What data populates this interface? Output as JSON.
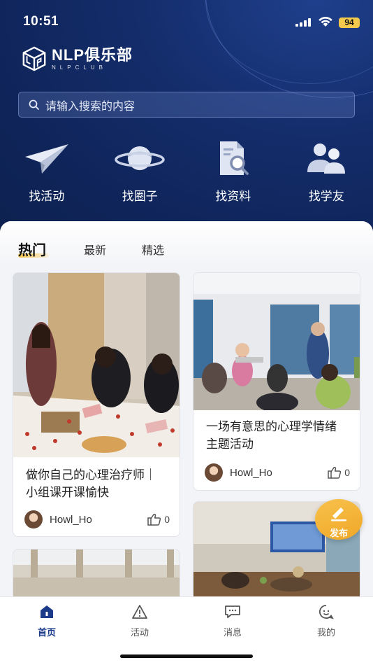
{
  "status": {
    "time": "10:51",
    "battery": "94"
  },
  "brand": {
    "name": "NLP俱乐部",
    "sub": "NLPCLUB"
  },
  "search": {
    "placeholder": "请输入搜索的内容"
  },
  "quick_links": [
    {
      "label": "找活动",
      "icon": "paper-plane-icon"
    },
    {
      "label": "找圈子",
      "icon": "planet-icon"
    },
    {
      "label": "找资料",
      "icon": "document-search-icon"
    },
    {
      "label": "找学友",
      "icon": "users-icon"
    }
  ],
  "feed_tabs": [
    {
      "label": "热门",
      "active": true
    },
    {
      "label": "最新",
      "active": false
    },
    {
      "label": "精选",
      "active": false
    }
  ],
  "posts": [
    {
      "title": "做你自己的心理治疗师｜小组课开课愉快",
      "author": "Howl_Ho",
      "likes": "0"
    },
    {
      "title": "一场有意思的心理学情绪主题活动",
      "author": "Howl_Ho",
      "likes": "0"
    }
  ],
  "fab": {
    "label": "发布"
  },
  "tabbar": [
    {
      "label": "首页",
      "active": true
    },
    {
      "label": "活动",
      "active": false
    },
    {
      "label": "消息",
      "active": false
    },
    {
      "label": "我的",
      "active": false
    }
  ],
  "colors": {
    "hero": "#0f2459",
    "accent": "#f0a827",
    "active_tab": "#1b3a8a"
  }
}
